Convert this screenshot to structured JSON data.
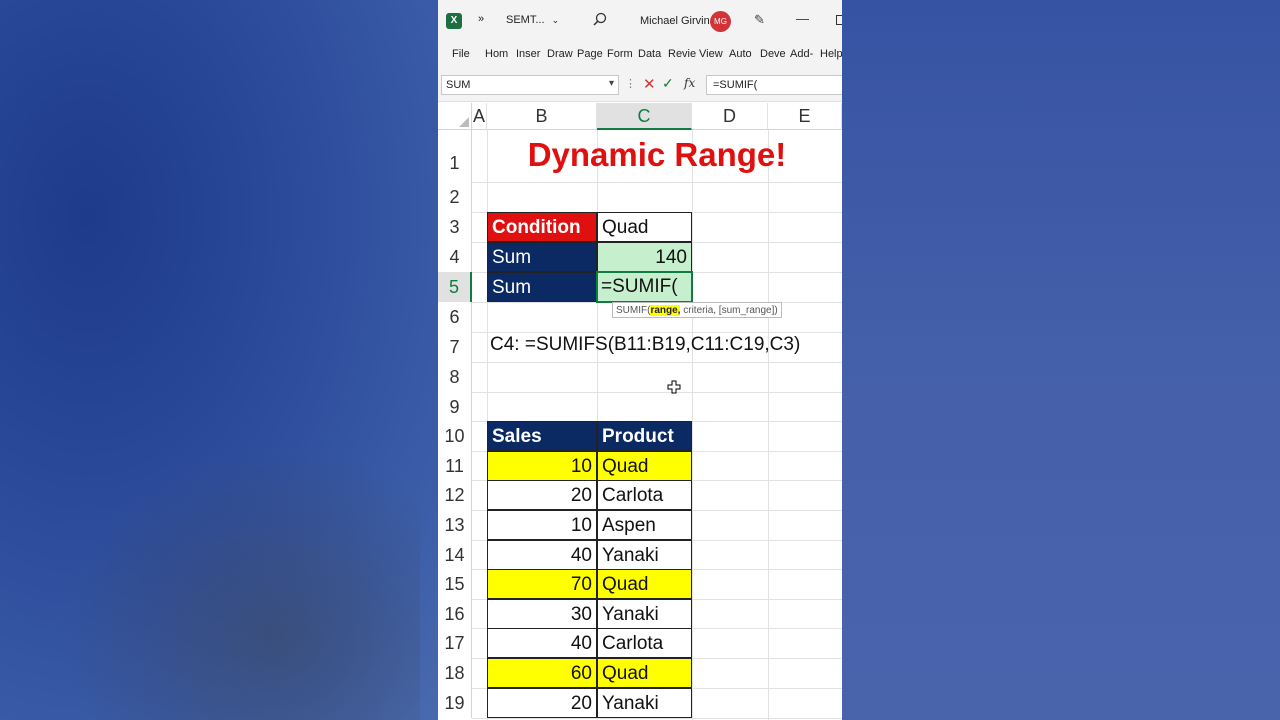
{
  "window": {
    "app_icon": "excel-icon",
    "more_glyph": "»",
    "file_name": "SEMT...",
    "user_name": "Michael Girvin",
    "user_initials": "MG",
    "accent": "#107c41"
  },
  "ribbon": {
    "tabs": [
      "File",
      "Hom",
      "Inser",
      "Draw",
      "Page",
      "Form",
      "Data",
      "Revie",
      "View",
      "Auto",
      "Deve",
      "Add-",
      "Help"
    ]
  },
  "formula_bar": {
    "name_box": "SUM",
    "formula": "=SUMIF("
  },
  "columns": [
    "A",
    "B",
    "C",
    "D",
    "E"
  ],
  "rows": [
    "1",
    "2",
    "3",
    "4",
    "5",
    "6",
    "7",
    "8",
    "9",
    "10",
    "11",
    "12",
    "13",
    "14",
    "15",
    "16",
    "17",
    "18",
    "19"
  ],
  "sheet": {
    "title": "Dynamic Range!",
    "condition_label": "Condition",
    "condition_value": "Quad",
    "sum_label_1": "Sum",
    "sum_value": "140",
    "sum_label_2": "Sum",
    "editing_formula": "=SUMIF(",
    "tooltip_fn": "SUMIF(",
    "tooltip_arg1": "range,",
    "tooltip_rest": " criteria, [sum_range])",
    "note": "C4: =SUMIFS(B11:B19,C11:C19,C3)",
    "table_headers": [
      "Sales",
      "Product"
    ],
    "table_rows": [
      {
        "sales": "10",
        "product": "Quad"
      },
      {
        "sales": "20",
        "product": "Carlota"
      },
      {
        "sales": "10",
        "product": "Aspen"
      },
      {
        "sales": "40",
        "product": "Yanaki"
      },
      {
        "sales": "70",
        "product": "Quad"
      },
      {
        "sales": "30",
        "product": "Yanaki"
      },
      {
        "sales": "40",
        "product": "Carlota"
      },
      {
        "sales": "60",
        "product": "Quad"
      },
      {
        "sales": "20",
        "product": "Yanaki"
      }
    ],
    "colors": {
      "title_red": "#e00f10",
      "navy": "#0b2a64",
      "green": "#c6efce",
      "yellow": "#ffff00"
    }
  }
}
